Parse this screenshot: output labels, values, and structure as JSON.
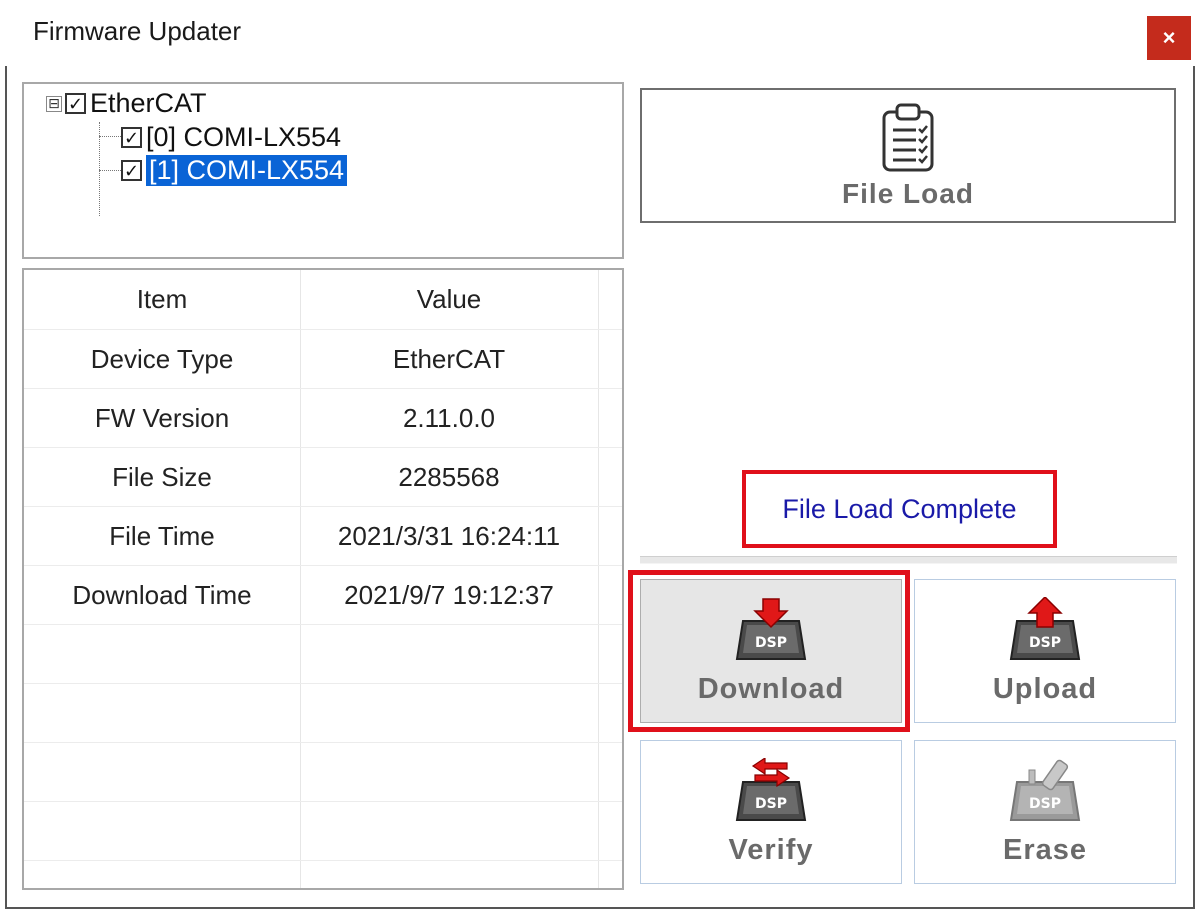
{
  "window": {
    "title": "Firmware Updater",
    "close_symbol": "×"
  },
  "tree": {
    "root": {
      "label": "EtherCAT",
      "checked": true,
      "expander": "⊟"
    },
    "children": [
      {
        "label": "[0] COMI-LX554",
        "checked": true,
        "selected": false
      },
      {
        "label": "[1] COMI-LX554",
        "checked": true,
        "selected": true
      }
    ],
    "check_symbol": "✓"
  },
  "table": {
    "headers": [
      "Item",
      "Value"
    ],
    "rows": [
      [
        "Device Type",
        "EtherCAT"
      ],
      [
        "FW Version",
        "2.11.0.0"
      ],
      [
        "File Size",
        "2285568"
      ],
      [
        "File Time",
        "2021/3/31 16:24:11"
      ],
      [
        "Download Time",
        "2021/9/7 19:12:37"
      ]
    ]
  },
  "buttons": {
    "file_load": "File Load",
    "download": "Download",
    "upload": "Upload",
    "verify": "Verify",
    "erase": "Erase",
    "chip_text": "DSP"
  },
  "status": {
    "message": "File Load Complete"
  },
  "colors": {
    "highlight_red": "#e0101a",
    "selection_blue": "#0a64d6",
    "status_text": "#1a1aa8",
    "close_red": "#c42b1c"
  }
}
